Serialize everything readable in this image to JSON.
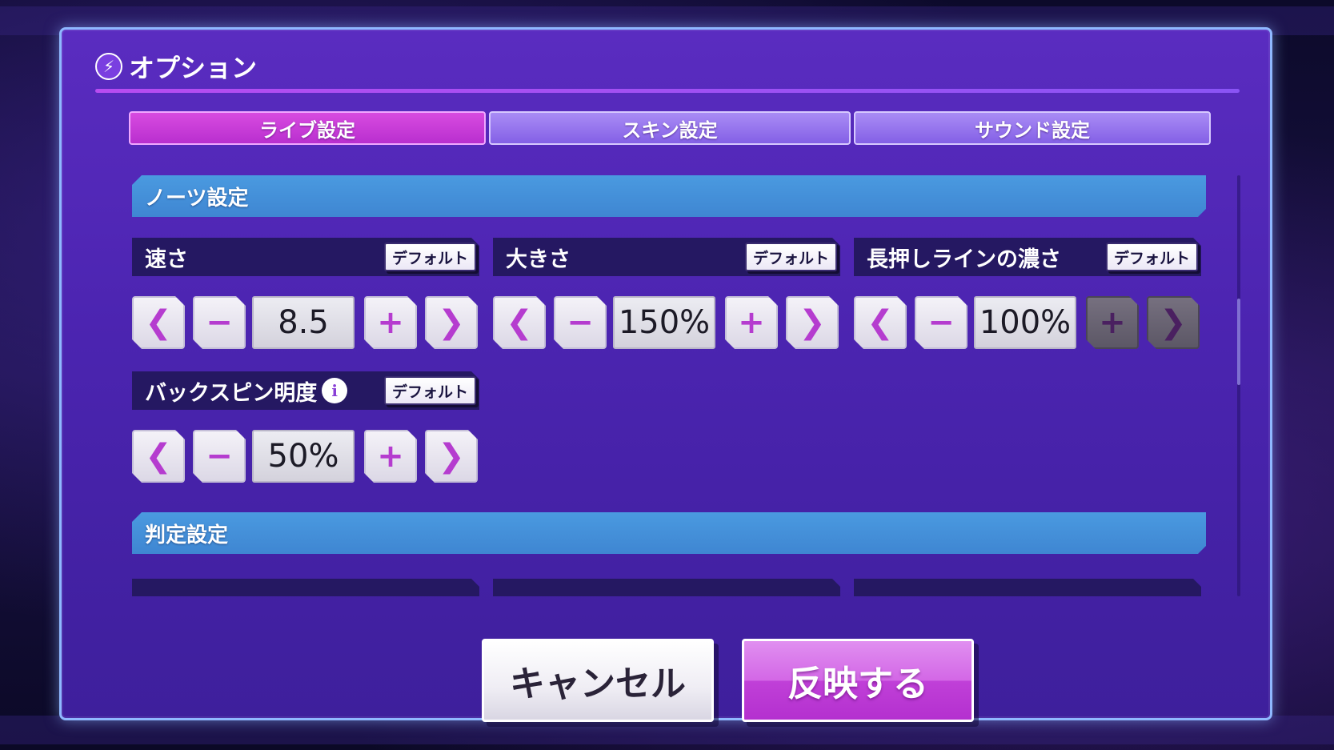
{
  "dialog": {
    "title": "オプション",
    "title_icon": "lightning-bolt-icon"
  },
  "tabs": [
    {
      "label": "ライブ設定",
      "active": true
    },
    {
      "label": "スキン設定",
      "active": false
    },
    {
      "label": "サウンド設定",
      "active": false
    }
  ],
  "sections": {
    "notes": {
      "title": "ノーツ設定",
      "settings": [
        {
          "name": "速さ",
          "default_label": "デフォルト",
          "value": "8.5",
          "has_info": false,
          "plus_enabled": true,
          "next_enabled": true
        },
        {
          "name": "大きさ",
          "default_label": "デフォルト",
          "value": "150%",
          "has_info": false,
          "plus_enabled": true,
          "next_enabled": true
        },
        {
          "name": "長押しラインの濃さ",
          "default_label": "デフォルト",
          "value": "100%",
          "has_info": false,
          "plus_enabled": false,
          "next_enabled": false
        },
        {
          "name": "バックスピン明度",
          "default_label": "デフォルト",
          "value": "50%",
          "has_info": true,
          "plus_enabled": true,
          "next_enabled": true
        }
      ]
    },
    "judgement": {
      "title": "判定設定"
    }
  },
  "controls": {
    "prev_glyph": "❮",
    "minus_glyph": "−",
    "plus_glyph": "+",
    "next_glyph": "❯",
    "info_glyph": "i"
  },
  "footer": {
    "cancel_label": "キャンセル",
    "apply_label": "反映する"
  },
  "colors": {
    "active_tab": "#c93ad8",
    "inactive_tab": "#9374ee",
    "section_bar": "#4591da",
    "setting_header": "#251862",
    "control_glyph": "#b53ccf",
    "apply_button": "#c84de0"
  }
}
